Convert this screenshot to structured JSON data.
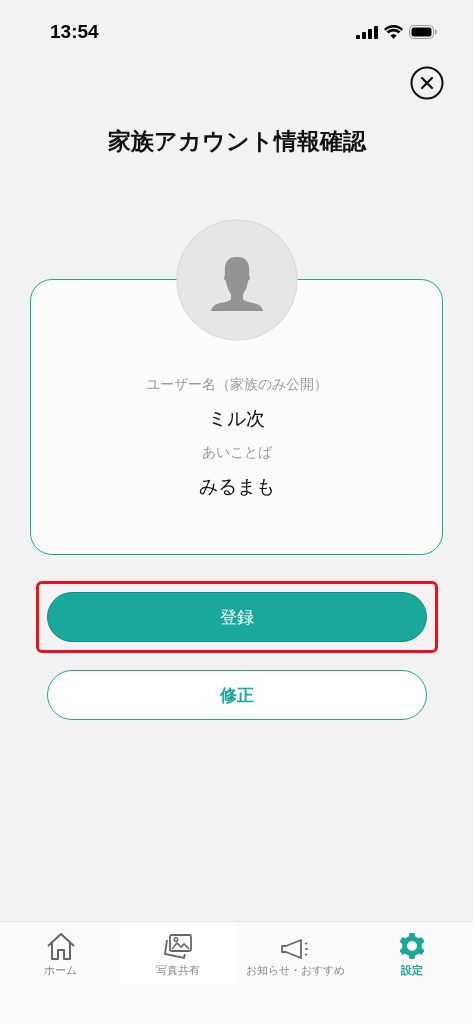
{
  "status_bar": {
    "time": "13:54"
  },
  "header": {
    "title": "家族アカウント情報確認"
  },
  "profile": {
    "fields": [
      {
        "label": "ユーザー名（家族のみ公開）",
        "value": "ミル次"
      },
      {
        "label": "あいことば",
        "value": "みるまも"
      }
    ]
  },
  "buttons": [
    {
      "label": "登録",
      "kind": "primary",
      "highlighted": true
    },
    {
      "label": "修正",
      "kind": "secondary",
      "highlighted": false
    }
  ],
  "tab_bar": [
    {
      "label": "ホーム",
      "kind": "home",
      "selected": false
    },
    {
      "label": "写真共有",
      "kind": "photos",
      "selected": false
    },
    {
      "label": "お知らせ・おすすめ",
      "kind": "news",
      "selected": false
    },
    {
      "label": "設定",
      "kind": "settings",
      "selected": true
    }
  ]
}
